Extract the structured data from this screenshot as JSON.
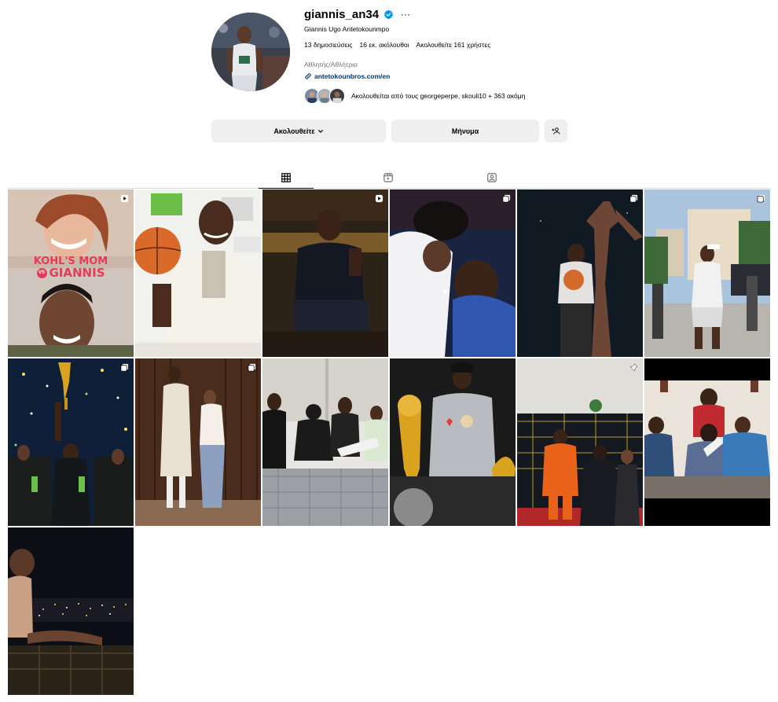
{
  "profile": {
    "username": "giannis_an34",
    "full_name": "Giannis Ugo Antetokounmpo",
    "verified": true,
    "posts_count_label": "13 δημοσιεύσεις",
    "followers_label": "16 εκ. ακόλουθοι",
    "following_label": "Ακολουθείτε 161 χρήστες",
    "category": "Αθλητής/Αθλήτρια",
    "link": "antetokounbros.com/en",
    "followed_by": "Ακολουθείται από τους georgeperpe, skouli10 + 363 ακόμη"
  },
  "actions": {
    "following_label": "Ακολουθείτε",
    "message_label": "Μήνυμα"
  },
  "tabs": [
    {
      "icon": "grid-icon",
      "active": true
    },
    {
      "icon": "reels-icon",
      "active": false
    },
    {
      "icon": "tagged-icon",
      "active": false
    }
  ],
  "posts": [
    {
      "badge": "reel-icon",
      "text": "KOHL'S MOM"
    },
    {
      "badge": "",
      "text": ""
    },
    {
      "badge": "reel-icon",
      "text": ""
    },
    {
      "badge": "carousel-icon",
      "text": ""
    },
    {
      "badge": "carousel-icon",
      "text": ""
    },
    {
      "badge": "carousel-icon",
      "text": ""
    },
    {
      "badge": "carousel-icon",
      "text": ""
    },
    {
      "badge": "carousel-icon",
      "text": ""
    },
    {
      "badge": "",
      "text": ""
    },
    {
      "badge": "",
      "text": ""
    },
    {
      "badge": "pin-icon",
      "text": ""
    },
    {
      "badge": "",
      "text": ""
    },
    {
      "badge": "",
      "text": ""
    }
  ],
  "post1_overlay": {
    "line1": "KOHL'S MOM",
    "vs": "VS",
    "line2": "GIANNIS"
  },
  "colors": {
    "verified": "#0095f6",
    "link": "#00376b",
    "button_bg": "#efefef",
    "muted": "#737373"
  }
}
